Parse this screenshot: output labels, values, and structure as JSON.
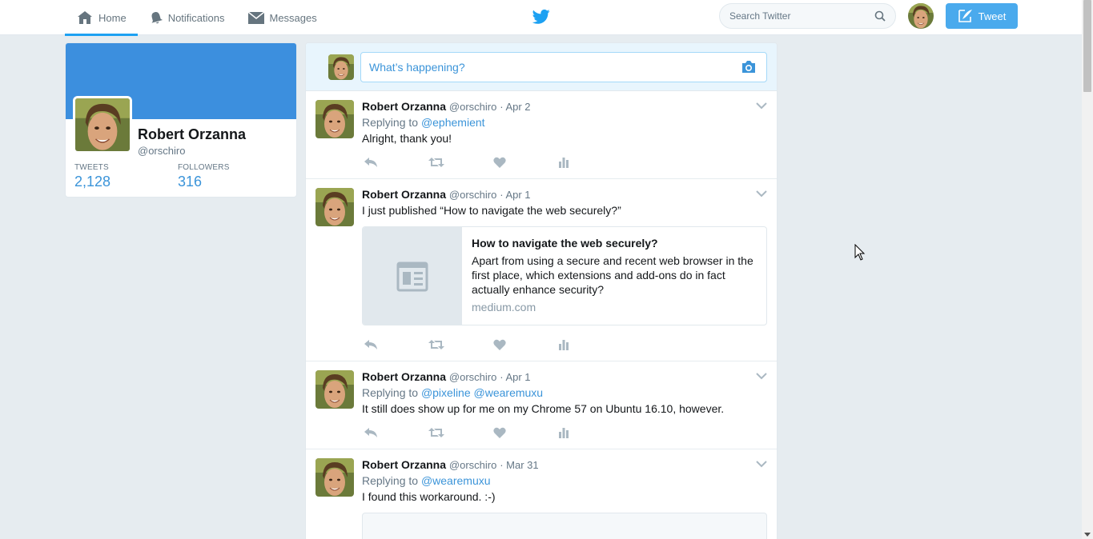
{
  "nav": {
    "home": "Home",
    "notifications": "Notifications",
    "messages": "Messages"
  },
  "search": {
    "placeholder": "Search Twitter"
  },
  "tweet_button": "Tweet",
  "colors": {
    "brand": "#1da1f2",
    "link": "#3b94d9",
    "banner": "#3c8fde"
  },
  "profile": {
    "name": "Robert Orzanna",
    "handle": "@orschiro",
    "tweets_label": "TWEETS",
    "tweets_value": "2,128",
    "followers_label": "FOLLOWERS",
    "followers_value": "316"
  },
  "composer": {
    "placeholder": "What’s happening?"
  },
  "tweets": [
    {
      "name": "Robert Orzanna",
      "handle": "@orschiro",
      "date": "· Apr 2",
      "reply_prefix": "Replying to",
      "mentions": "@ephemient",
      "text": "Alright, thank you!"
    },
    {
      "name": "Robert Orzanna",
      "handle": "@orschiro",
      "date": "· Apr 1",
      "text": "I just published “How to navigate the web securely?”",
      "card": {
        "title": "How to navigate the web securely?",
        "description": "Apart from using a secure and recent web browser in the first place, which extensions and add-ons do in fact actually enhance security?",
        "domain": "medium.com"
      }
    },
    {
      "name": "Robert Orzanna",
      "handle": "@orschiro",
      "date": "· Apr 1",
      "reply_prefix": "Replying to",
      "mentions": "@pixeline @wearemuxu",
      "text": "It still does show up for me on my Chrome 57 on Ubuntu 16.10, however."
    },
    {
      "name": "Robert Orzanna",
      "handle": "@orschiro",
      "date": "· Mar 31",
      "reply_prefix": "Replying to",
      "mentions": "@wearemuxu",
      "text": "I found this workaround. :-)"
    }
  ],
  "icons": {
    "home": "home-icon",
    "notifications": "bell-icon",
    "messages": "envelope-icon",
    "brand": "twitter-bird-icon",
    "search": "search-icon",
    "compose": "quill-icon",
    "camera": "camera-icon",
    "reply": "reply-icon",
    "retweet": "retweet-icon",
    "like": "heart-icon",
    "analytics": "analytics-icon",
    "caret": "chevron-down-icon",
    "article": "article-icon"
  }
}
